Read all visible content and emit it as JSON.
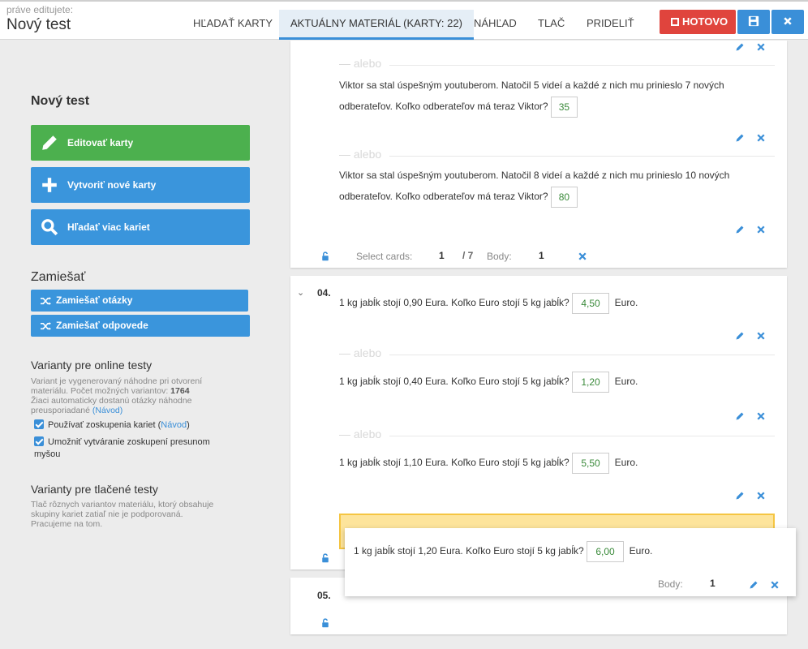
{
  "header": {
    "editing_label": "práve editujete:",
    "title": "Nový test",
    "tabs": [
      "HĽADAŤ KARTY",
      "AKTUÁLNY MATERIÁL (KARTY: 22)",
      "NÁHĽAD",
      "TLAČ",
      "PRIDELIŤ"
    ],
    "done_label": "HOTOVO"
  },
  "sidebar": {
    "title": "Nový test",
    "edit_cards": "Editovať karty",
    "create_cards": "Vytvoriť nové karty",
    "search_cards": "Hľadať viac kariet",
    "shuffle_heading": "Zamiešať",
    "shuffle_questions": "Zamiešať otázky",
    "shuffle_answers": "Zamiešať odpovede",
    "online_heading": "Varianty pre online testy",
    "online_info_1": "Variant je vygenerovaný náhodne pri otvorení materiálu. Počet možných variantov:",
    "online_count": "1764",
    "online_info_2": "Žiaci automaticky dostanú otázky náhodne preusporiadané",
    "guide": "(Návod)",
    "use_groups": "Používať zoskupenia kariet",
    "guide_link": "Návod",
    "allow_groups": "Umožniť vytváranie zoskupení presunom myšou",
    "print_heading": "Varianty pre tlačené testy",
    "print_info": "Tlač rôznych variantov materiálu, ktorý obsahuje skupiny kariet zatiaľ nie je podporovaná. Pracujeme na tom."
  },
  "cards": {
    "alebo": "— alebo",
    "q3a_line1": "Viktor sa stal úspešným youtuberom. Natočil 5 videí a každé z nich mu prinieslo 7 nových",
    "q3a_line2": "odberateľov. Koľko odberateľov má teraz Viktor?",
    "q3a_ans": "35",
    "q3b_line1": "Viktor sa stal úspešným youtuberom. Natočil 8 videí a každé z nich mu prinieslo 10 nových",
    "q3b_line2": "odberateľov. Koľko odberateľov má teraz Viktor?",
    "q3b_ans": "80",
    "select_cards": "Select cards:",
    "select_value": "1",
    "select_total": "/ 7",
    "points_label": "Body:",
    "points_value": "1",
    "q4_num": "04.",
    "q4_text_a": "1 kg jabĺk stojí 0,90 Eura. Koľko Euro stojí 5 kg jabĺk?",
    "q4_ans_a": "4,50",
    "q4_text_b": "1 kg jabĺk stojí 0,40 Eura. Koľko Euro stojí 5 kg jabĺk?",
    "q4_ans_b": "1,20",
    "q4_text_c": "1 kg jabĺk stojí 1,10 Eura. Koľko Euro stojí 5 kg jabĺk?",
    "q4_ans_c": "5,50",
    "q4_text_d": "1 kg jabĺk stojí 1,20 Eura. Koľko Euro stojí 5 kg jabĺk?",
    "q4_ans_d": "6,00",
    "unit": "Euro.",
    "q5_num": "05."
  },
  "colors": {
    "accent": "#3a8fd8",
    "done": "#e0443d",
    "green": "#4cb04e",
    "highlight": "#fde49b"
  }
}
